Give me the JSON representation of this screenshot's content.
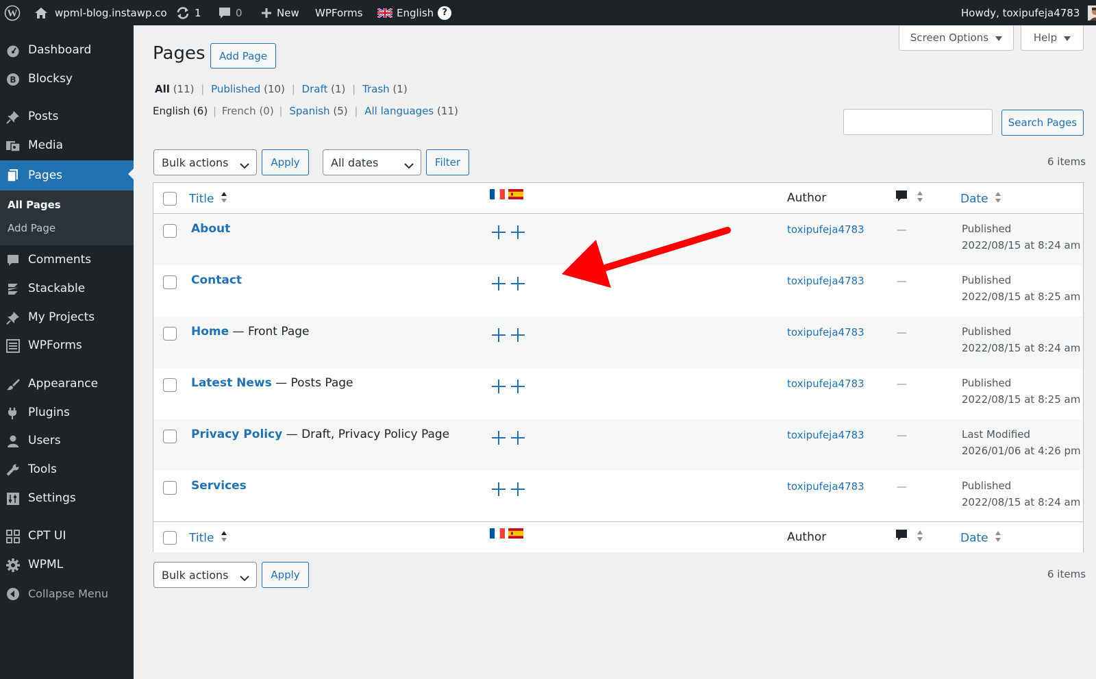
{
  "adminbar": {
    "site_name": "wpml-blog.instawp.co",
    "updates_count": "1",
    "comments_count": "0",
    "new_label": "New",
    "wpforms_label": "WPForms",
    "language_label": "English",
    "help_glyph": "?",
    "howdy": "Howdy, toxipufeja4783",
    "icons": [
      "wordpress-logo-icon",
      "home-icon",
      "updates-icon",
      "comment-icon",
      "plus-icon",
      "uk-flag-icon",
      "help-icon",
      "avatar"
    ]
  },
  "sidebar": {
    "items": [
      {
        "label": "Dashboard",
        "icon": "dashboard-icon"
      },
      {
        "label": "Blocksy",
        "icon": "blocksy-icon"
      },
      {
        "label": "Posts",
        "icon": "pin-icon"
      },
      {
        "label": "Media",
        "icon": "media-icon"
      },
      {
        "label": "Pages",
        "icon": "pages-icon"
      },
      {
        "label": "Comments",
        "icon": "comment-icon"
      },
      {
        "label": "Stackable",
        "icon": "stackable-icon"
      },
      {
        "label": "My Projects",
        "icon": "pin-icon"
      },
      {
        "label": "WPForms",
        "icon": "forms-icon"
      },
      {
        "label": "Appearance",
        "icon": "brush-icon"
      },
      {
        "label": "Plugins",
        "icon": "plugin-icon"
      },
      {
        "label": "Users",
        "icon": "users-icon"
      },
      {
        "label": "Tools",
        "icon": "wrench-icon"
      },
      {
        "label": "Settings",
        "icon": "settings-icon"
      },
      {
        "label": "CPT UI",
        "icon": "grid-icon"
      },
      {
        "label": "WPML",
        "icon": "gear-icon"
      }
    ],
    "submenu": [
      "All Pages",
      "Add Page"
    ],
    "collapse_label": "Collapse Menu"
  },
  "header": {
    "title": "Pages",
    "add_page": "Add Page",
    "screen_options": "Screen Options",
    "help": "Help"
  },
  "status_filters": {
    "all": "All",
    "all_count": "(11)",
    "published": "Published",
    "published_count": "(10)",
    "draft": "Draft",
    "draft_count": "(1)",
    "trash": "Trash",
    "trash_count": "(1)",
    "sep": "|"
  },
  "language_filters": {
    "english": "English (6)",
    "french": "French (0)",
    "spanish": "Spanish",
    "spanish_count": "(5)",
    "all_languages": "All languages",
    "all_languages_count": "(11)",
    "sep": "|"
  },
  "search": {
    "value": "",
    "button": "Search Pages"
  },
  "tablenav": {
    "bulk_actions": "Bulk actions",
    "apply": "Apply",
    "all_dates": "All dates",
    "filter": "Filter",
    "items_count": "6 items"
  },
  "table": {
    "columns": {
      "title": "Title",
      "author": "Author",
      "date": "Date"
    },
    "rows": [
      {
        "title": "About",
        "state": "",
        "author": "toxipufeja4783",
        "comments": "—",
        "status": "Published",
        "date": "2022/08/15 at 8:24 am"
      },
      {
        "title": "Contact",
        "state": "",
        "author": "toxipufeja4783",
        "comments": "—",
        "status": "Published",
        "date": "2022/08/15 at 8:25 am"
      },
      {
        "title": "Home",
        "state": " — Front Page",
        "author": "toxipufeja4783",
        "comments": "—",
        "status": "Published",
        "date": "2022/08/15 at 8:24 am"
      },
      {
        "title": "Latest News",
        "state": " — Posts Page",
        "author": "toxipufeja4783",
        "comments": "—",
        "status": "Published",
        "date": "2022/08/15 at 8:25 am"
      },
      {
        "title": "Privacy Policy",
        "state": " — Draft, Privacy Policy Page",
        "author": "toxipufeja4783",
        "comments": "—",
        "status": "Last Modified",
        "date": "2026/01/06 at 4:26 pm"
      },
      {
        "title": "Services",
        "state": "",
        "author": "toxipufeja4783",
        "comments": "—",
        "status": "Published",
        "date": "2022/08/15 at 8:24 am"
      }
    ]
  },
  "colors": {
    "accent": "#2271b1",
    "admin_bar": "#1d2327",
    "arrow": "#ff0000"
  }
}
